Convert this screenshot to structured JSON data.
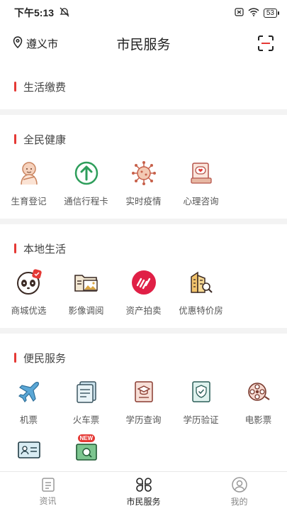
{
  "status": {
    "time": "下午5:13",
    "battery": "53"
  },
  "header": {
    "city": "遵义市",
    "title": "市民服务"
  },
  "sections": {
    "life_pay": {
      "title": "生活缴费"
    },
    "health": {
      "title": "全民健康",
      "items": [
        {
          "label": "生育登记",
          "icon": "baby-icon"
        },
        {
          "label": "通信行程卡",
          "icon": "arrow-up-circle-icon"
        },
        {
          "label": "实时疫情",
          "icon": "virus-icon"
        },
        {
          "label": "心理咨询",
          "icon": "heart-chat-icon"
        }
      ]
    },
    "local": {
      "title": "本地生活",
      "items": [
        {
          "label": "商城优选",
          "icon": "panda-shop-icon"
        },
        {
          "label": "影像调阅",
          "icon": "image-folder-icon"
        },
        {
          "label": "资产拍卖",
          "icon": "auction-icon"
        },
        {
          "label": "优惠特价房",
          "icon": "building-search-icon"
        }
      ]
    },
    "convenience": {
      "title": "便民服务",
      "items": [
        {
          "label": "机票",
          "icon": "airplane-icon"
        },
        {
          "label": "火车票",
          "icon": "train-ticket-icon"
        },
        {
          "label": "学历查询",
          "icon": "graduation-cap-icon"
        },
        {
          "label": "学历验证",
          "icon": "certificate-shield-icon"
        },
        {
          "label": "电影票",
          "icon": "film-reel-icon"
        },
        {
          "label": "",
          "icon": "id-card-icon"
        },
        {
          "label": "",
          "icon": "new-badge-icon",
          "badge": "NEW"
        }
      ]
    }
  },
  "tabs": [
    {
      "label": "资讯",
      "icon": "news-icon"
    },
    {
      "label": "市民服务",
      "icon": "clover-grid-icon",
      "active": true
    },
    {
      "label": "我的",
      "icon": "profile-icon"
    }
  ],
  "colors": {
    "accent": "#e53935",
    "green": "#2e9e5b",
    "orange": "#f08a3c"
  }
}
